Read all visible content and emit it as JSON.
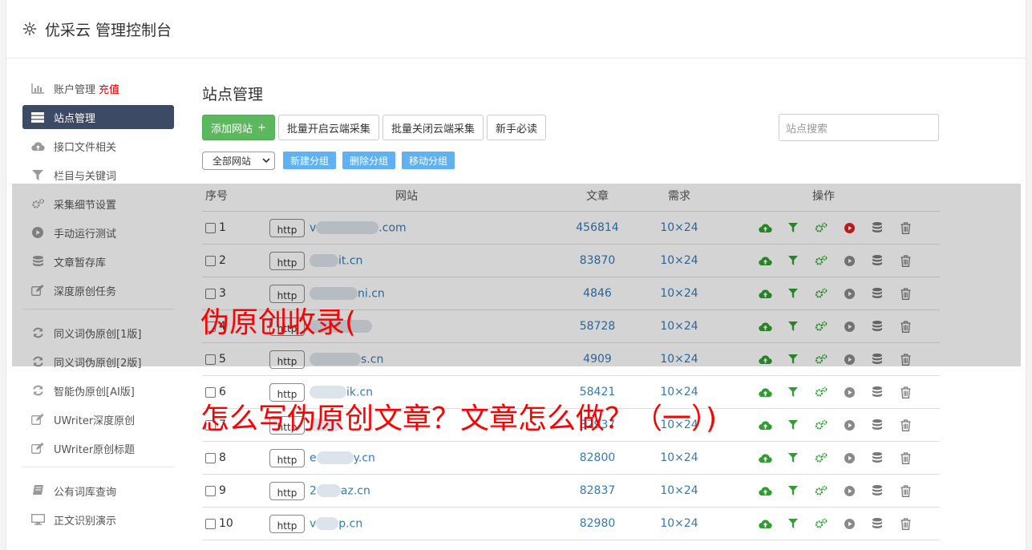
{
  "header": {
    "title": "优采云 管理控制台"
  },
  "sidebar": {
    "items": [
      {
        "label": "账户管理",
        "extra": "充值",
        "icon": "bar-chart-icon",
        "active": false
      },
      {
        "label": "站点管理",
        "icon": "server-icon",
        "active": true
      },
      {
        "label": "接口文件相关",
        "icon": "cloud-upload-icon",
        "active": false
      },
      {
        "label": "栏目与关键词",
        "icon": "filter-icon",
        "active": false
      },
      {
        "label": "采集细节设置",
        "icon": "gears-icon",
        "active": false
      },
      {
        "label": "手动运行测试",
        "icon": "play-circle-icon",
        "active": false
      },
      {
        "label": "文章暂存库",
        "icon": "database-icon",
        "active": false
      },
      {
        "label": "深度原创任务",
        "icon": "edit-icon",
        "active": false
      }
    ],
    "items2": [
      {
        "label": "同义词伪原创[1版]",
        "icon": "refresh-icon"
      },
      {
        "label": "同义词伪原创[2版]",
        "icon": "refresh-icon"
      },
      {
        "label": "智能伪原创[AI版]",
        "icon": "refresh-icon"
      },
      {
        "label": "UWriter深度原创",
        "icon": "edit-icon"
      },
      {
        "label": "UWriter原创标题",
        "icon": "edit-icon"
      }
    ],
    "items3": [
      {
        "label": "公有词库查询",
        "icon": "book-icon"
      },
      {
        "label": "正文识别演示",
        "icon": "monitor-icon"
      }
    ]
  },
  "main": {
    "title": "站点管理",
    "toolbar": {
      "add_label": "添加网站",
      "add_icon": "+",
      "batch_open_label": "批量开启云端采集",
      "batch_close_label": "批量关闭云端采集",
      "guide_label": "新手必读",
      "search_placeholder": "站点搜索"
    },
    "toolbar2": {
      "group_select_value": "全部网站",
      "new_group_label": "新建分组",
      "delete_group_label": "删除分组",
      "move_group_label": "移动分组"
    },
    "table": {
      "headers": {
        "no": "序号",
        "site": "网站",
        "articles": "文章",
        "need": "需求",
        "ops": "操作"
      },
      "rows": [
        {
          "no": "1",
          "http": "http",
          "prefix": "v",
          "suffix": ".com",
          "articles": "456814",
          "need": "10×24",
          "running": true
        },
        {
          "no": "2",
          "http": "http",
          "prefix": "",
          "suffix": "it.cn",
          "articles": "83870",
          "need": "10×24",
          "running": false
        },
        {
          "no": "3",
          "http": "http",
          "prefix": "",
          "suffix": "ni.cn",
          "articles": "4846",
          "need": "10×24",
          "running": false
        },
        {
          "no": "4",
          "http": "http",
          "prefix": "",
          "suffix": "",
          "articles": "58728",
          "need": "10×24",
          "running": false
        },
        {
          "no": "5",
          "http": "http",
          "prefix": "",
          "suffix": "s.cn",
          "articles": "4909",
          "need": "10×24",
          "running": false
        },
        {
          "no": "6",
          "http": "http",
          "prefix": "",
          "suffix": "ik.cn",
          "articles": "58421",
          "need": "10×24",
          "running": false
        },
        {
          "no": "7",
          "http": "http",
          "prefix": "",
          "suffix": "",
          "articles": "82937",
          "need": "10×24",
          "running": false
        },
        {
          "no": "8",
          "http": "http",
          "prefix": "e",
          "suffix": "y.cn",
          "articles": "82800",
          "need": "10×24",
          "running": false
        },
        {
          "no": "9",
          "http": "http",
          "prefix": "2",
          "suffix": "az.cn",
          "articles": "82837",
          "need": "10×24",
          "running": false
        },
        {
          "no": "10",
          "http": "http",
          "prefix": "v",
          "suffix": "p.cn",
          "articles": "82980",
          "need": "10×24",
          "running": false
        }
      ]
    }
  },
  "overlay": {
    "line1": "伪原创收录(",
    "line2": "怎么写伪原创文章？文章怎么做？（一）)"
  },
  "colors": {
    "accent": "#3c4a66",
    "green": "#5cb85c",
    "link": "#337ab7",
    "overlay_text": "#ff0000",
    "small_button": "#5fb1f1"
  }
}
